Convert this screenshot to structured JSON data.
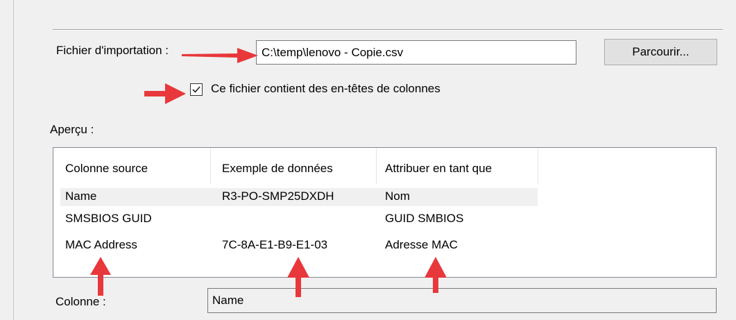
{
  "import_section": {
    "file_label": "Fichier d'importation :",
    "file_value": "C:\\temp\\lenovo - Copie.csv",
    "browse_label": "Parcourir...",
    "has_headers_label": "Ce fichier contient des en-têtes de colonnes",
    "has_headers_checked": true
  },
  "preview": {
    "label": "Aperçu :",
    "columns": [
      "Colonne source",
      "Exemple de données",
      "Attribuer en tant que"
    ],
    "rows": [
      [
        "Name",
        "R3-PO-SMP25DXDH",
        "Nom"
      ],
      [
        "SMSBIOS GUID",
        "",
        "GUID SMBIOS"
      ],
      [
        "MAC Address",
        "7C-8A-E1-B9-E1-03",
        "Adresse MAC"
      ]
    ],
    "selected_row": 0
  },
  "column_field": {
    "label": "Colonne :",
    "value": "Name"
  },
  "colors": {
    "annotation_arrow": "#e8383b",
    "panel_background": "#f0f0f0"
  },
  "icons": [
    "checkmark-icon",
    "annotation-arrow"
  ]
}
